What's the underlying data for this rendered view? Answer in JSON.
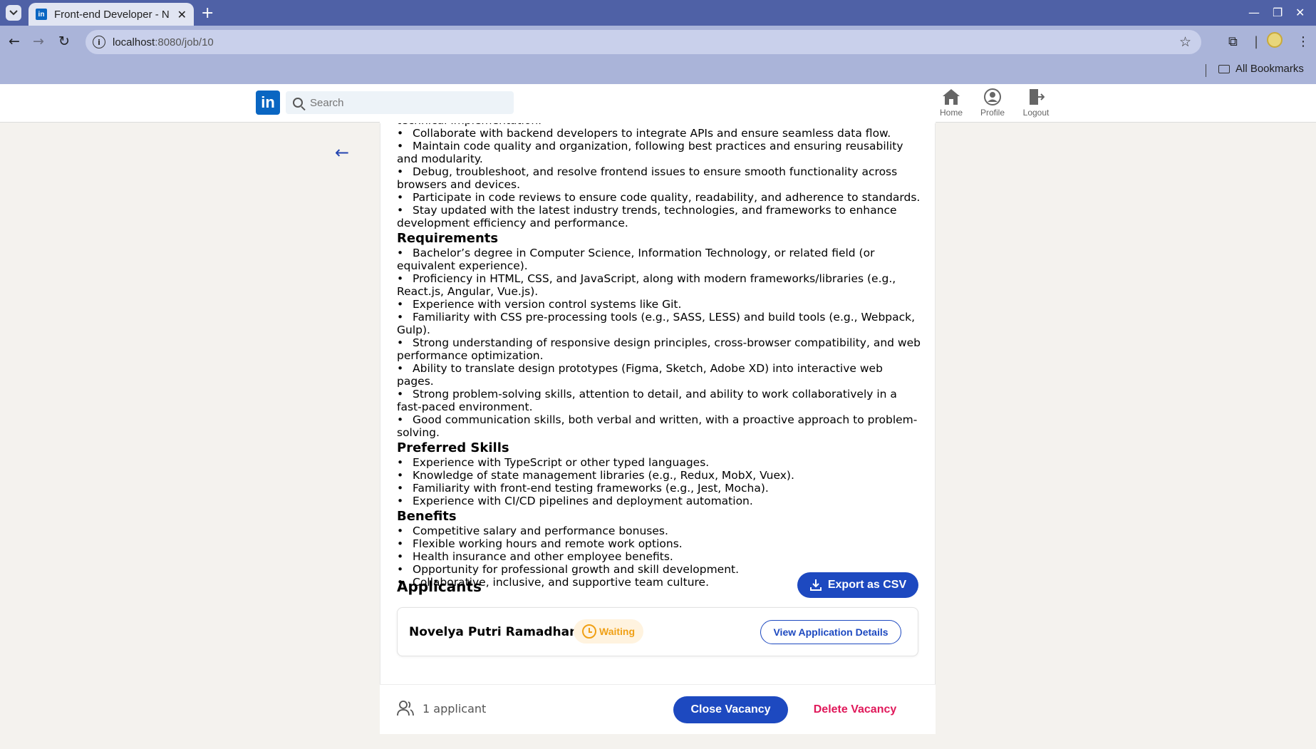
{
  "browser": {
    "tab_title": "Front-end Developer - N",
    "tab_favicon": "in",
    "url_host": "localhost",
    "url_rest": ":8080/job/10",
    "bookmarks_label": "All Bookmarks"
  },
  "header": {
    "logo_text": "in",
    "search_placeholder": "Search",
    "nav": {
      "home": "Home",
      "profile": "Profile",
      "logout": "Logout"
    }
  },
  "description": {
    "lines_top": [
      "technical implementation.",
      "Collaborate with backend developers to integrate APIs and ensure seamless data flow.",
      "Maintain code quality and organization, following best practices and ensuring reusability and modularity.",
      "Debug, troubleshoot, and resolve frontend issues to ensure smooth functionality across browsers and devices.",
      "Participate in code reviews to ensure code quality, readability, and adherence to standards.",
      "Stay updated with the latest industry trends, technologies, and frameworks to enhance development efficiency and performance."
    ],
    "requirements_title": "Requirements",
    "requirements": [
      "Bachelor’s degree in Computer Science, Information Technology, or related field (or equivalent experience).",
      "Proficiency in HTML, CSS, and JavaScript, along with modern frameworks/libraries (e.g., React.js, Angular, Vue.js).",
      "Experience with version control systems like Git.",
      "Familiarity with CSS pre-processing tools (e.g., SASS, LESS) and build tools (e.g., Webpack, Gulp).",
      "Strong understanding of responsive design principles, cross-browser compatibility, and web performance optimization.",
      "Ability to translate design prototypes (Figma, Sketch, Adobe XD) into interactive web pages.",
      "Strong problem-solving skills, attention to detail, and ability to work collaboratively in a fast-paced environment.",
      "Good communication skills, both verbal and written, with a proactive approach to problem-solving."
    ],
    "preferred_title": "Preferred Skills",
    "preferred": [
      "Experience with TypeScript or other typed languages.",
      "Knowledge of state management libraries (e.g., Redux, MobX, Vuex).",
      "Familiarity with front-end testing frameworks (e.g., Jest, Mocha).",
      "Experience with CI/CD pipelines and deployment automation."
    ],
    "benefits_title": "Benefits",
    "benefits": [
      "Competitive salary and performance bonuses.",
      "Flexible working hours and remote work options.",
      "Health insurance and other employee benefits.",
      "Opportunity for professional growth and skill development.",
      "Collaborative, inclusive, and supportive team culture."
    ]
  },
  "applicants": {
    "title": "Applicants",
    "export_label": "Export as CSV",
    "list": [
      {
        "name": "Novelya Putri Ramadhani",
        "status": "Waiting",
        "action": "View Application Details"
      }
    ]
  },
  "footer": {
    "count_text": "1 applicant",
    "close_label": "Close Vacancy",
    "delete_label": "Delete Vacancy"
  },
  "colors": {
    "primary": "#1d49c0",
    "danger": "#e0185a",
    "waiting": "#f0a015",
    "brand": "#0a66c2"
  }
}
